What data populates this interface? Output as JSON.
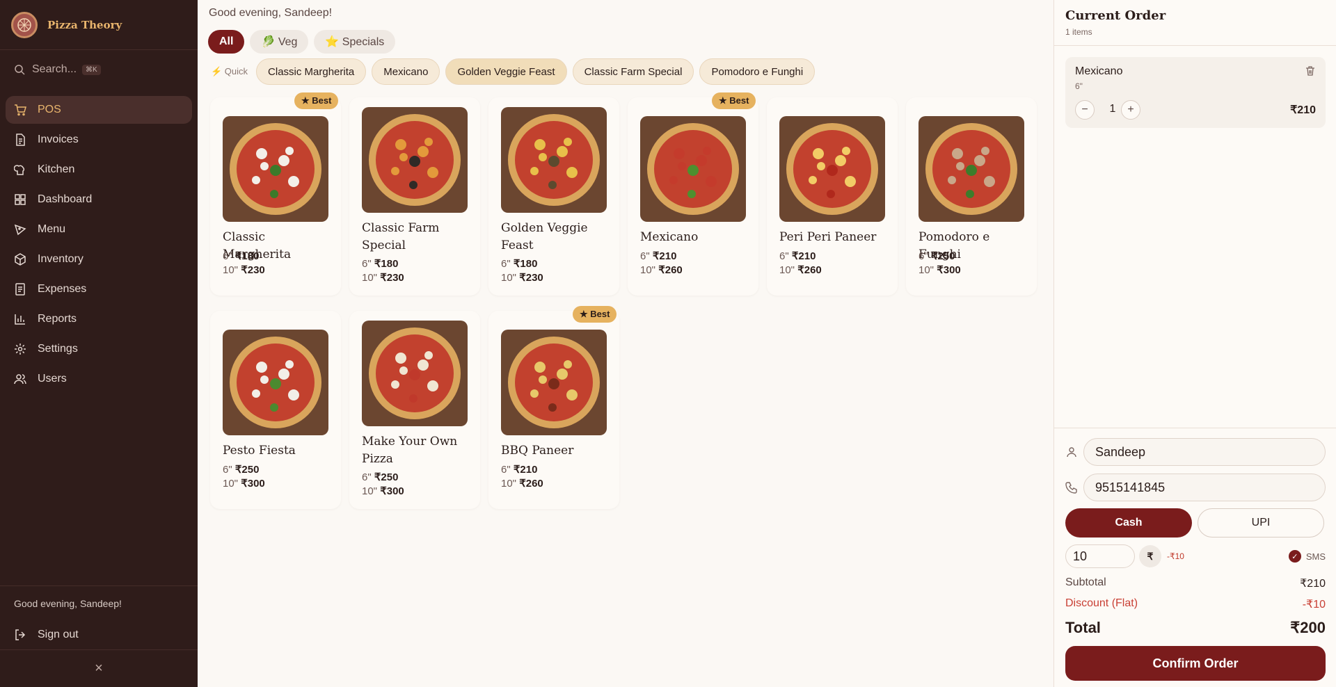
{
  "brand": {
    "name": "Pizza Theory"
  },
  "search": {
    "placeholder": "Search...",
    "shortcut": "⌘K"
  },
  "nav": [
    {
      "label": "POS",
      "icon": "cart-icon",
      "active": true
    },
    {
      "label": "Invoices",
      "icon": "file-icon"
    },
    {
      "label": "Kitchen",
      "icon": "chef-hat-icon"
    },
    {
      "label": "Dashboard",
      "icon": "grid-icon"
    },
    {
      "label": "Menu",
      "icon": "pizza-icon"
    },
    {
      "label": "Inventory",
      "icon": "box-icon"
    },
    {
      "label": "Expenses",
      "icon": "receipt-icon"
    },
    {
      "label": "Reports",
      "icon": "bar-chart-icon"
    },
    {
      "label": "Settings",
      "icon": "gear-icon"
    },
    {
      "label": "Users",
      "icon": "users-icon"
    }
  ],
  "sidebar_footer": {
    "greeting": "Good evening, Sandeep!",
    "signout": "Sign out",
    "collapse": "×"
  },
  "main": {
    "greeting": "Good evening, Sandeep!",
    "filters": [
      {
        "label": "All",
        "active": true
      },
      {
        "label": "🥬 Veg"
      },
      {
        "label": "⭐ Specials"
      }
    ],
    "quick_label": "⚡ Quick",
    "quick_items": [
      {
        "label": "Classic Margherita"
      },
      {
        "label": "Mexicano"
      },
      {
        "label": "Golden Veggie Feast",
        "highlight": true
      },
      {
        "label": "Classic Farm Special"
      },
      {
        "label": "Pomodoro e Funghi"
      }
    ]
  },
  "products": [
    {
      "name": "Classic Margherita",
      "best": true,
      "p6": "₹180",
      "p10": "₹230",
      "topping": "#f3efe8",
      "leaf": "#3c7a2a"
    },
    {
      "name": "Classic Farm Special",
      "p6": "₹180",
      "p10": "₹230",
      "topping": "#e39a3b",
      "leaf": "#2f2a26"
    },
    {
      "name": "Golden Veggie Feast",
      "p6": "₹180",
      "p10": "₹230",
      "topping": "#e8c04a",
      "leaf": "#5c4a2e"
    },
    {
      "name": "Mexicano",
      "best": true,
      "p6": "₹210",
      "p10": "₹260",
      "topping": "#c43b2c",
      "leaf": "#4e8f2f"
    },
    {
      "name": "Peri Peri Paneer",
      "p6": "₹210",
      "p10": "₹260",
      "topping": "#f2cc66",
      "leaf": "#b0281c"
    },
    {
      "name": "Pomodoro e Funghi",
      "p6": "₹250",
      "p10": "₹300",
      "topping": "#c9a789",
      "leaf": "#3d7c2b"
    },
    {
      "name": "Pesto Fiesta",
      "p6": "₹250",
      "p10": "₹300",
      "topping": "#f2efe8",
      "leaf": "#4b8a2f"
    },
    {
      "name": "Make Your Own Pizza",
      "p6": "₹250",
      "p10": "₹300",
      "topping": "#f0e6d2",
      "leaf": "#c0392b"
    },
    {
      "name": "BBQ Paneer",
      "best": true,
      "p6": "₹210",
      "p10": "₹260",
      "topping": "#e7c86a",
      "leaf": "#7a2b1a"
    }
  ],
  "product_labels": {
    "best": "★ Best",
    "size6": "6\"",
    "size10": "10\""
  },
  "order": {
    "title": "Current Order",
    "count": "1 items",
    "items": [
      {
        "name": "Mexicano",
        "size": "6\"",
        "qty": "1",
        "price": "₹210"
      }
    ],
    "customer_name": "Sandeep",
    "phone": "9515141845",
    "pay_cash": "Cash",
    "pay_upi": "UPI",
    "discount_value": "10",
    "discount_type": "₹",
    "discount_applied": "-₹10",
    "sms_label": "SMS",
    "subtotal_label": "Subtotal",
    "subtotal": "₹210",
    "discount_label": "Discount (Flat)",
    "discount": "-₹10",
    "total_label": "Total",
    "total": "₹200",
    "confirm": "Confirm Order"
  },
  "colors": {
    "sidebar": "#2f1c1a",
    "accent": "#7a1c1c",
    "gold": "#e9b56d",
    "badge": "#e6b25f"
  }
}
